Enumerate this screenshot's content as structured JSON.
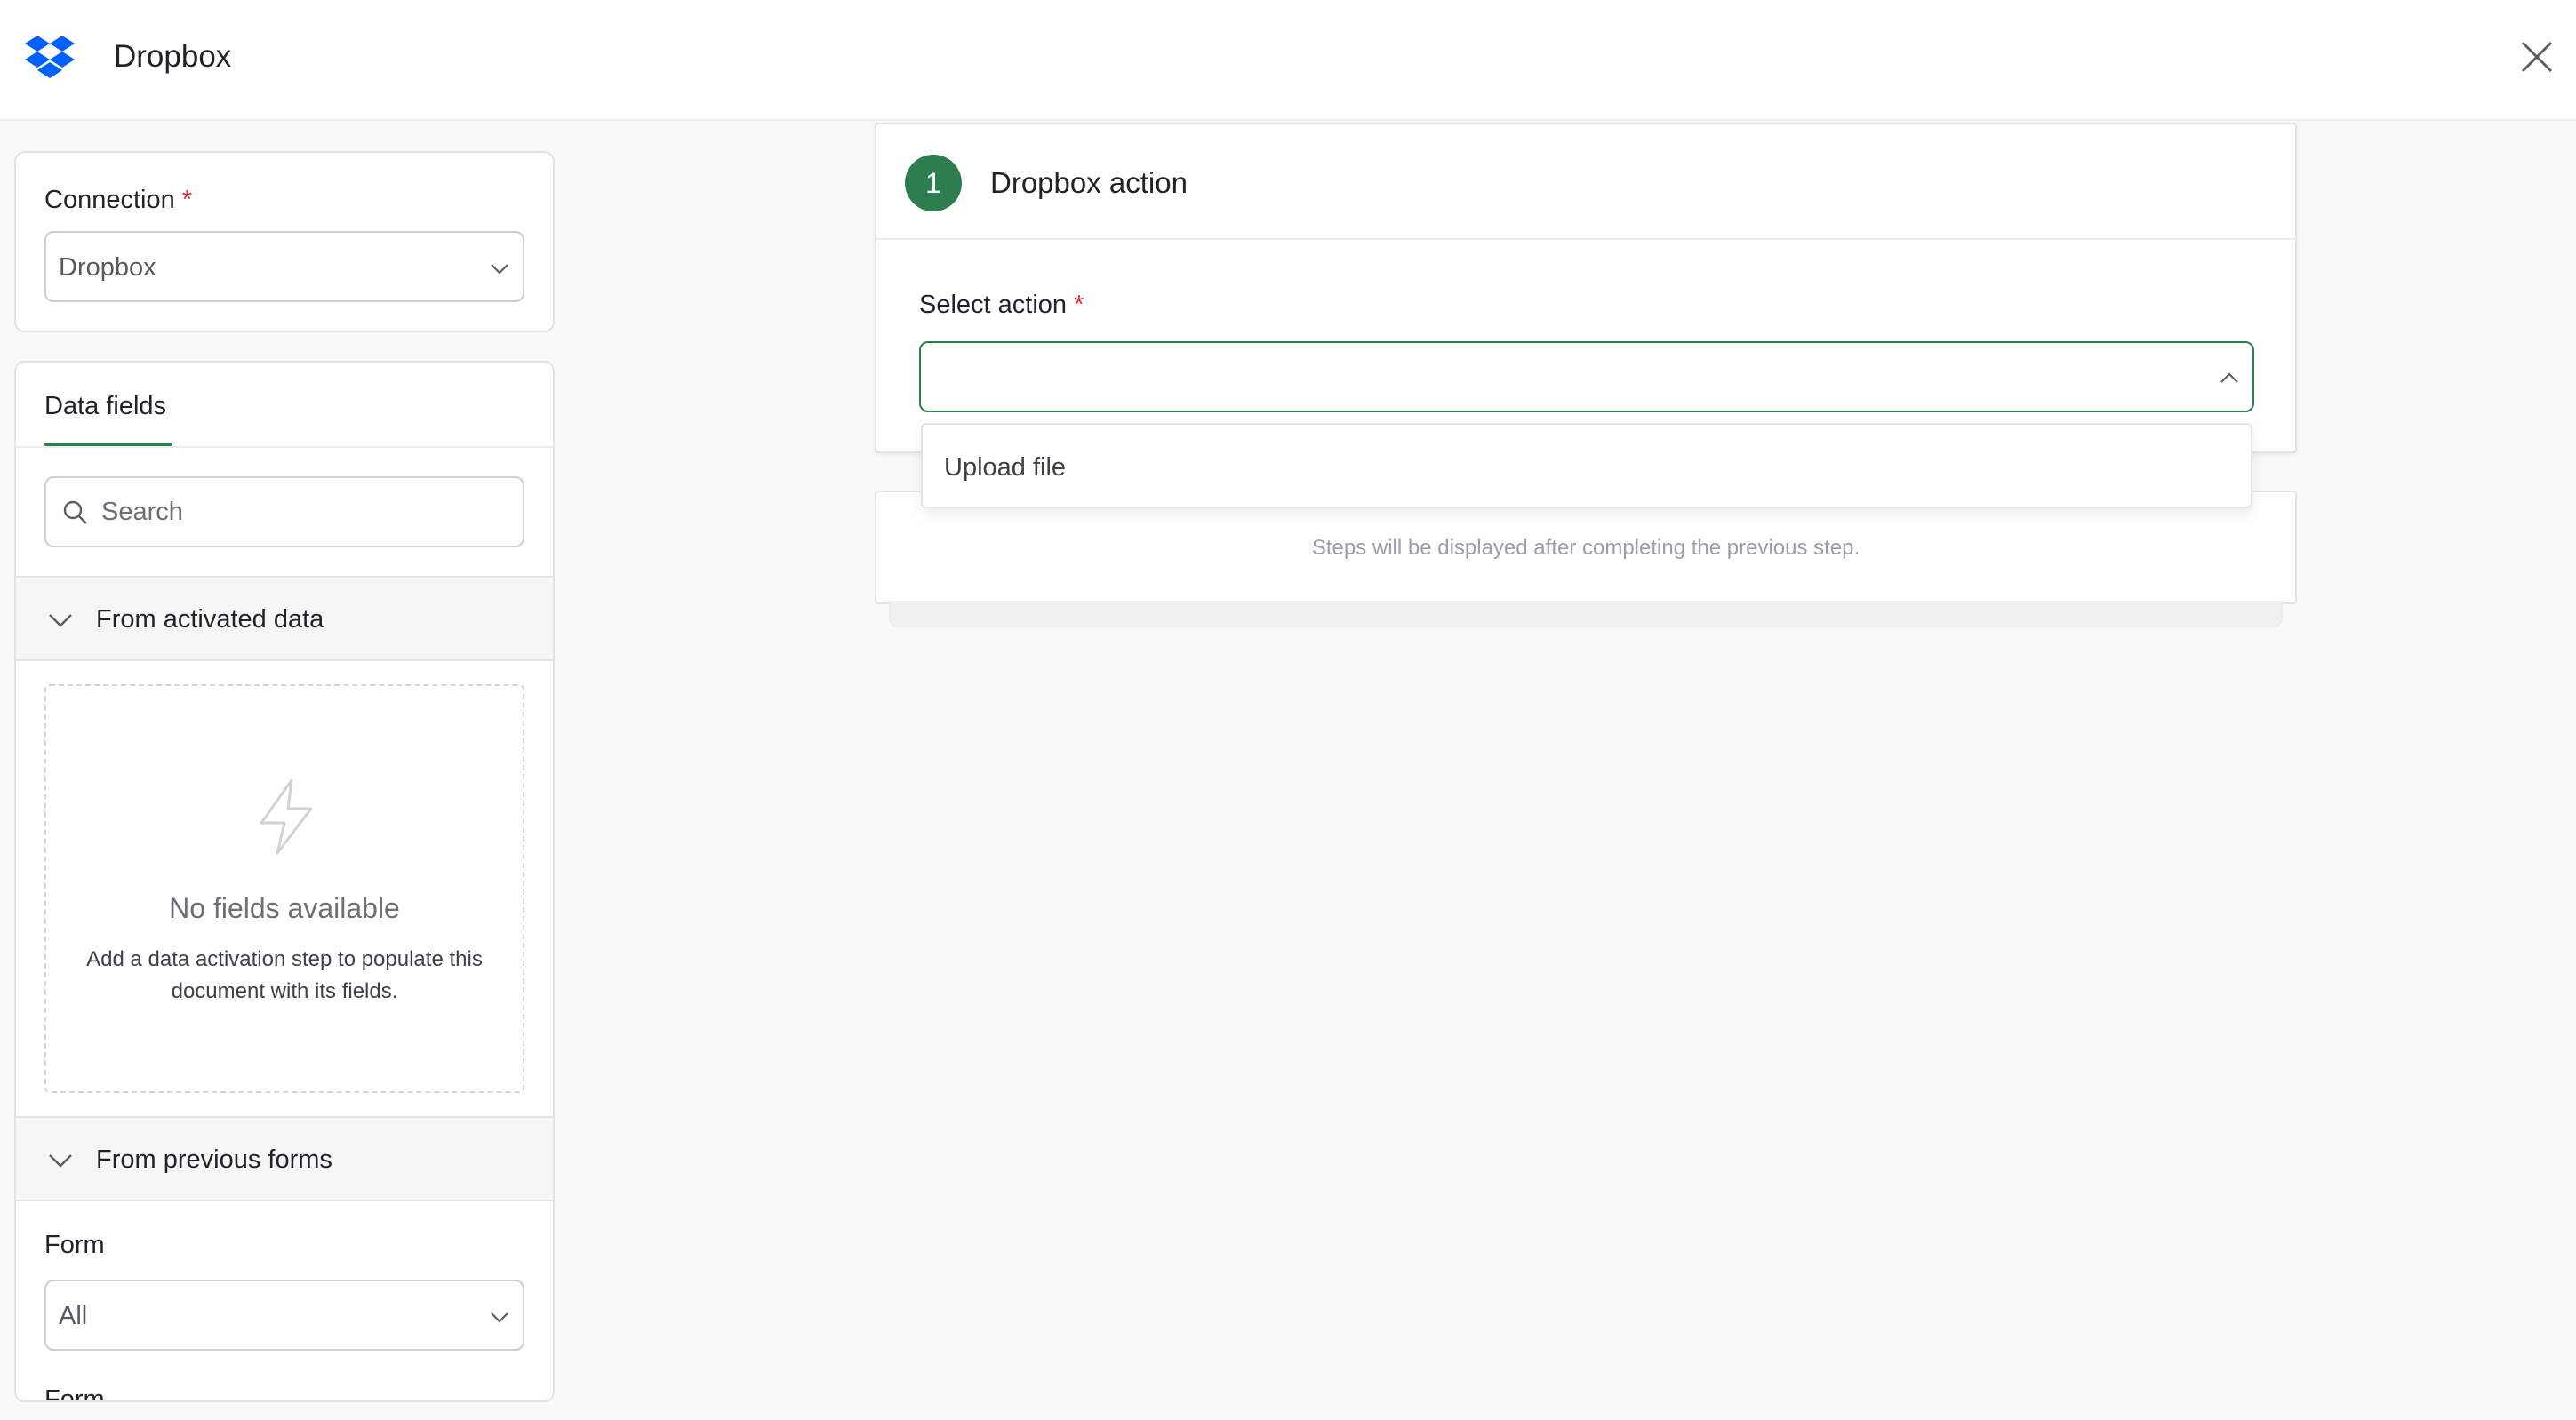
{
  "header": {
    "title": "Dropbox",
    "logo_icon": "dropbox-logo",
    "close_icon": "close-icon",
    "brand_color": "#0061FE"
  },
  "connection": {
    "label": "Connection",
    "required_mark": "*",
    "value": "Dropbox"
  },
  "data_fields": {
    "tab_label": "Data fields",
    "search_placeholder": "Search",
    "sections": {
      "activated": {
        "title": "From activated data",
        "empty_title": "No fields available",
        "empty_description": "Add a data activation step to populate this document with its fields."
      },
      "previous_forms": {
        "title": "From previous forms",
        "form_label": "Form",
        "form_value": "All",
        "next_label": "Form"
      }
    }
  },
  "step": {
    "number": "1",
    "title": "Dropbox action",
    "select_label": "Select action",
    "required_mark": "*",
    "selected_value": "",
    "options": [
      "Upload file"
    ]
  },
  "pending": {
    "message": "Steps will be displayed after completing the previous step."
  },
  "colors": {
    "accent": "#2E7D4F",
    "required": "#D32F2F",
    "background": "#F9F9F9"
  }
}
